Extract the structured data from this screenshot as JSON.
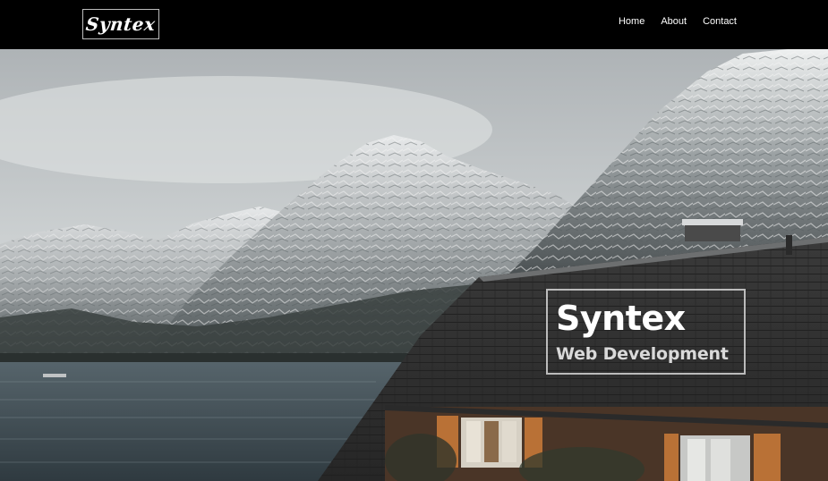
{
  "brand": {
    "logo_text": "Syntex"
  },
  "nav": {
    "items": [
      {
        "label": "Home"
      },
      {
        "label": "About"
      },
      {
        "label": "Contact"
      }
    ]
  },
  "hero": {
    "title": "Syntex",
    "subtitle": "Web Development",
    "background": "snowy mountains above a lake with a dark-roofed house",
    "colors": {
      "navbar": "#000000",
      "sky": "#c9cdcf",
      "lake": "#3e4a51",
      "roof": "#2e2e2e",
      "heading": "#ffffff"
    }
  }
}
